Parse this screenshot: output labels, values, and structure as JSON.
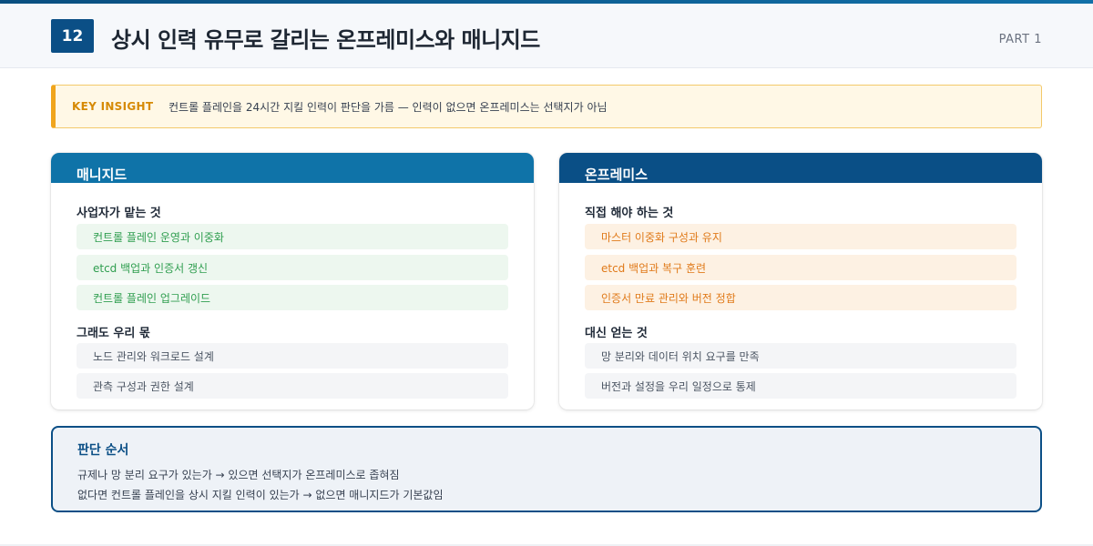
{
  "header": {
    "number": "12",
    "title": "상시 인력 유무로 갈리는 온프레미스와 매니지드",
    "part": "PART 1"
  },
  "insight": {
    "tag": "KEY INSIGHT",
    "text": "컨트롤 플레인을 24시간 지킬 인력이 판단을 가름 — 인력이 없으면 온프레미스는 선택지가 아님"
  },
  "managed": {
    "title": "매니지드",
    "section1_title": "사업자가 맡는 것",
    "section1_items": [
      "컨트롤 플레인 운영과 이중화",
      "etcd 백업과 인증서 갱신",
      "컨트롤 플레인 업그레이드"
    ],
    "section2_title": "그래도 우리 몫",
    "section2_items": [
      "노드 관리와 워크로드 설계",
      "관측 구성과 권한 설계"
    ]
  },
  "onprem": {
    "title": "온프레미스",
    "section1_title": "직접 해야 하는 것",
    "section1_items": [
      "마스터 이중화 구성과 유지",
      "etcd 백업과 복구 훈련",
      "인증서 만료 관리와 버전 정합"
    ],
    "section2_title": "대신 얻는 것",
    "section2_items": [
      "망 분리와 데이터 위치 요구를 만족",
      "버전과 설정을 우리 일정으로 통제"
    ]
  },
  "decision": {
    "title": "판단 순서",
    "lines": [
      "규제나 망 분리 요구가 있는가 → 있으면 선택지가 온프레미스로 좁혀짐",
      "없다면 컨트롤 플레인을 상시 지킬 인력이 있는가 → 없으면 매니지드가 기본값임"
    ]
  },
  "colors": {
    "brand_dark": "#0b4f86",
    "brand_mid": "#0f73a8",
    "insight_accent": "#f0a51d",
    "green_text": "#2f9e4f",
    "orange_text": "#e07a1a"
  }
}
